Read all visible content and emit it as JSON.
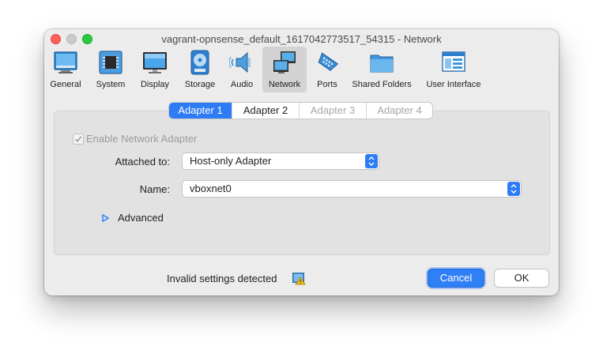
{
  "window": {
    "title": "vagrant-opnsense_default_1617042773517_54315 - Network"
  },
  "toolbar": {
    "items": [
      {
        "label": "General",
        "icon": "general-icon"
      },
      {
        "label": "System",
        "icon": "chip-icon"
      },
      {
        "label": "Display",
        "icon": "monitor-icon"
      },
      {
        "label": "Storage",
        "icon": "disk-icon"
      },
      {
        "label": "Audio",
        "icon": "speaker-icon"
      },
      {
        "label": "Network",
        "icon": "network-icon",
        "selected": true
      },
      {
        "label": "Ports",
        "icon": "serial-port-icon"
      },
      {
        "label": "Shared Folders",
        "icon": "folder-icon"
      },
      {
        "label": "User Interface",
        "icon": "window-icon"
      }
    ]
  },
  "tabs": [
    {
      "label": "Adapter 1",
      "state": "active"
    },
    {
      "label": "Adapter 2",
      "state": "enabled"
    },
    {
      "label": "Adapter 3",
      "state": "disabled"
    },
    {
      "label": "Adapter 4",
      "state": "disabled"
    }
  ],
  "form": {
    "enable_label": "Enable Network Adapter",
    "enable_checked": true,
    "attached_label": "Attached to:",
    "attached_value": "Host-only Adapter",
    "name_label": "Name:",
    "name_value": "vboxnet0",
    "advanced_label": "Advanced"
  },
  "footer": {
    "status": "Invalid settings detected",
    "cancel_label": "Cancel",
    "ok_label": "OK"
  },
  "colors": {
    "accent": "#2d7cf6",
    "close": "#fe5f57",
    "maximize": "#29c840"
  }
}
